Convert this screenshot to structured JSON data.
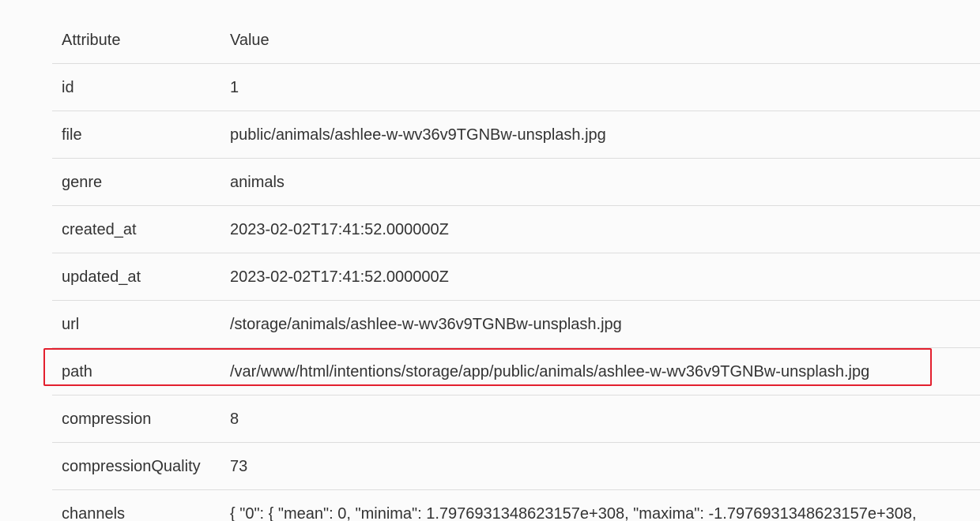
{
  "table": {
    "headers": {
      "attribute": "Attribute",
      "value": "Value"
    },
    "rows": [
      {
        "attribute": "id",
        "value": "1"
      },
      {
        "attribute": "file",
        "value": "public/animals/ashlee-w-wv36v9TGNBw-unsplash.jpg"
      },
      {
        "attribute": "genre",
        "value": "animals"
      },
      {
        "attribute": "created_at",
        "value": "2023-02-02T17:41:52.000000Z"
      },
      {
        "attribute": "updated_at",
        "value": "2023-02-02T17:41:52.000000Z"
      },
      {
        "attribute": "url",
        "value": "/storage/animals/ashlee-w-wv36v9TGNBw-unsplash.jpg"
      },
      {
        "attribute": "path",
        "value": "/var/www/html/intentions/storage/app/public/animals/ashlee-w-wv36v9TGNBw-unsplash.jpg"
      },
      {
        "attribute": "compression",
        "value": "8"
      },
      {
        "attribute": "compressionQuality",
        "value": "73"
      },
      {
        "attribute": "channels",
        "value": "{ \"0\": { \"mean\": 0, \"minima\": 1.7976931348623157e+308, \"maxima\": -1.7976931348623157e+308,"
      }
    ]
  },
  "highlight": {
    "color": "#e3202e",
    "target_row": "path"
  }
}
